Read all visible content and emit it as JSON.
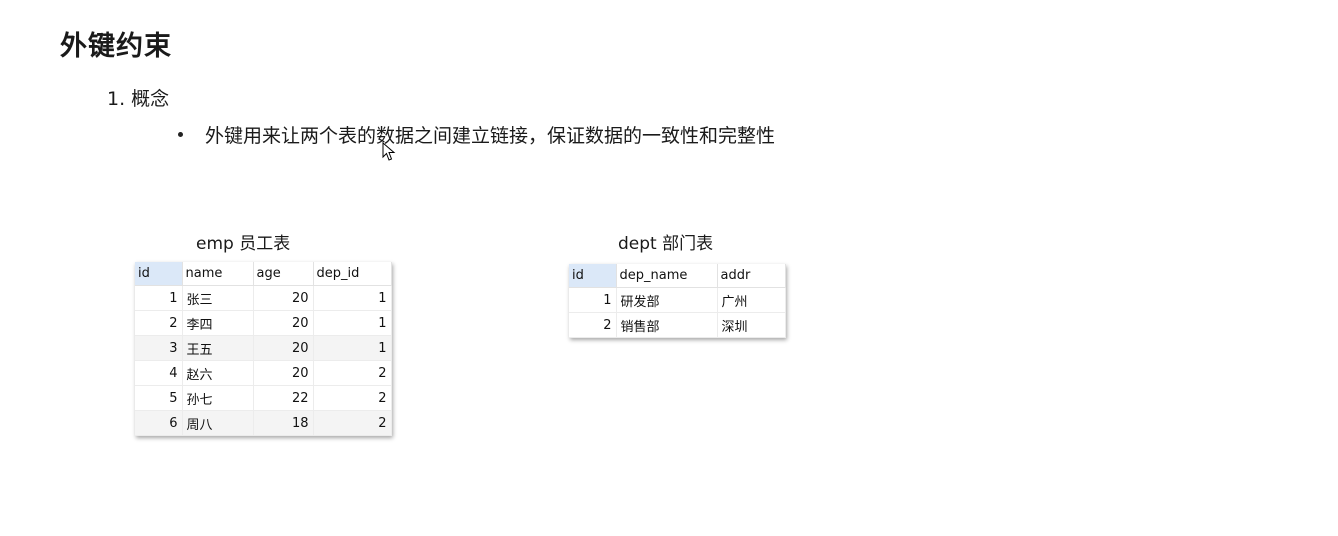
{
  "slide": {
    "title": "外键约束",
    "section": "1. 概念",
    "bullet": "外键用来让两个表的数据之间建立链接，保证数据的一致性和完整性"
  },
  "emp_table": {
    "caption": "emp 员工表",
    "columns": [
      "id",
      "name",
      "age",
      "dep_id"
    ],
    "rows": [
      [
        "1",
        "张三",
        "20",
        "1"
      ],
      [
        "2",
        "李四",
        "20",
        "1"
      ],
      [
        "3",
        "王五",
        "20",
        "1"
      ],
      [
        "4",
        "赵六",
        "20",
        "2"
      ],
      [
        "5",
        "孙七",
        "22",
        "2"
      ],
      [
        "6",
        "周八",
        "18",
        "2"
      ]
    ]
  },
  "dept_table": {
    "caption": "dept 部门表",
    "columns": [
      "id",
      "dep_name",
      "addr"
    ],
    "rows": [
      [
        "1",
        "研发部",
        "广州"
      ],
      [
        "2",
        "销售部",
        "深圳"
      ]
    ]
  },
  "colors": {
    "header_highlight": "#dbe8f8",
    "text": "#1a1a1a"
  },
  "icons": {
    "cursor": "arrow-cursor-icon"
  }
}
